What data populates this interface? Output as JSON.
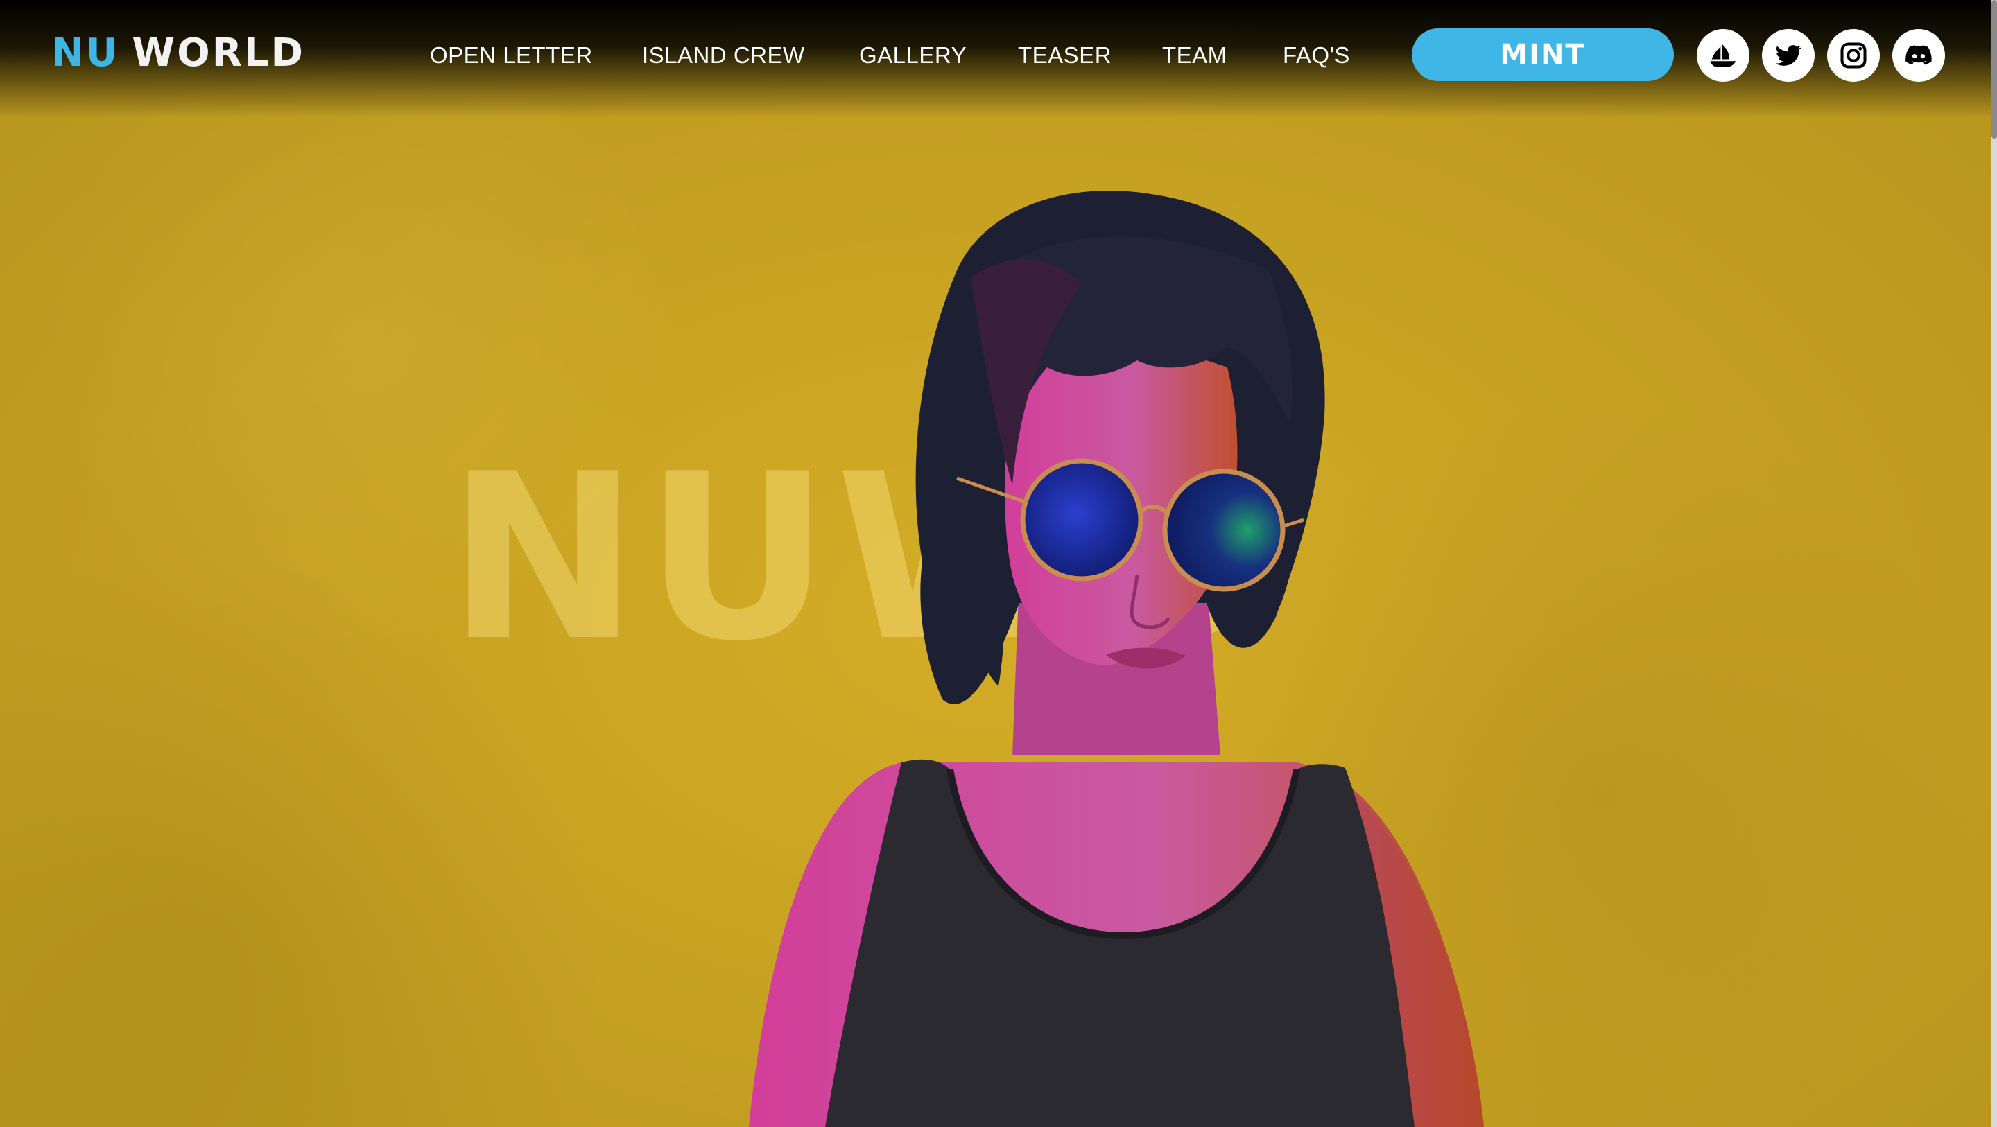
{
  "brand": {
    "logo_primary": "NU",
    "logo_secondary": "WORLD",
    "accent_color": "#3fb6e6"
  },
  "nav": {
    "items": [
      {
        "label": "OPEN LETTER"
      },
      {
        "label": "ISLAND CREW"
      },
      {
        "label": "GALLERY"
      },
      {
        "label": "TEASER"
      },
      {
        "label": "TEAM"
      },
      {
        "label": "FAQ'S"
      }
    ],
    "mint_label": "MINT"
  },
  "social": [
    {
      "icon": "opensea-icon"
    },
    {
      "icon": "twitter-icon"
    },
    {
      "icon": "instagram-icon"
    },
    {
      "icon": "discord-icon"
    }
  ],
  "hero": {
    "watermark": "NUWD",
    "background_color": "#c9a322"
  }
}
